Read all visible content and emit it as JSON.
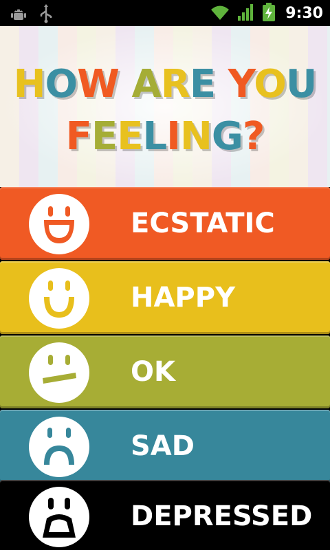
{
  "status_bar": {
    "time": "9:30",
    "icons": [
      "android-debug-icon",
      "usb-icon",
      "wifi-icon",
      "signal-icon",
      "battery-charging-icon"
    ]
  },
  "header": {
    "title_line1": "HOW ARE YOU",
    "title_line2": "FEELING?",
    "letter_colors": [
      "#e8c11f",
      "#3b8fa3",
      "#f05a22",
      "#a5ad36",
      "#e8c11f",
      "#3b8fa3",
      "#f05a22"
    ]
  },
  "moods": [
    {
      "label": "ECSTATIC",
      "icon": "ecstatic-face-icon",
      "color": "#f05a24"
    },
    {
      "label": "HAPPY",
      "icon": "happy-face-icon",
      "color": "#e8bf1c"
    },
    {
      "label": "OK",
      "icon": "neutral-face-icon",
      "color": "#a7ad35"
    },
    {
      "label": "SAD",
      "icon": "sad-face-icon",
      "color": "#37879b"
    },
    {
      "label": "DEPRESSED",
      "icon": "depressed-face-icon",
      "color": "#000000"
    }
  ]
}
